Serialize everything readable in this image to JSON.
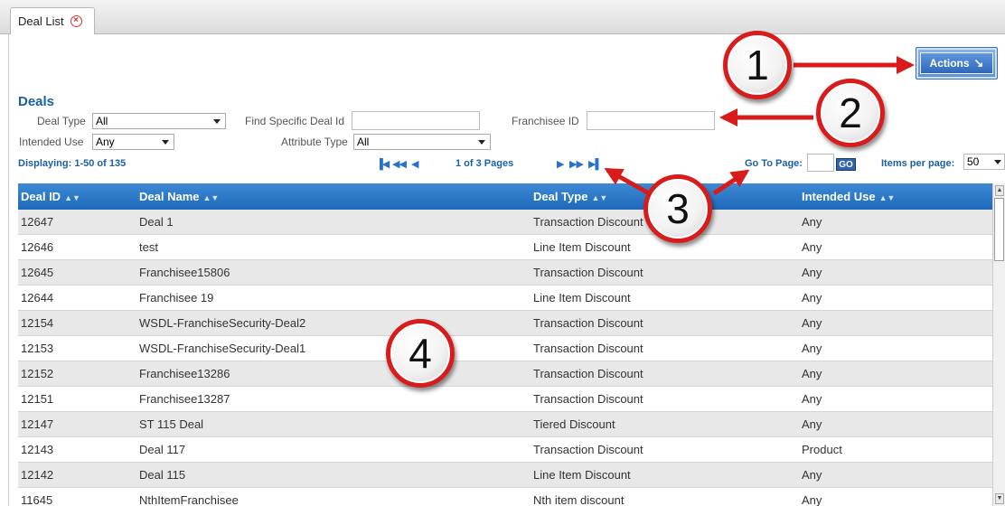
{
  "tab": {
    "label": "Deal List"
  },
  "actions": {
    "label": "Actions"
  },
  "deals_title": "Deals",
  "filters": {
    "deal_type": {
      "label": "Deal Type",
      "value": "All"
    },
    "find_deal": {
      "label": "Find Specific Deal Id",
      "value": ""
    },
    "franchisee": {
      "label": "Franchisee ID",
      "value": ""
    },
    "intended_use": {
      "label": "Intended Use",
      "value": "Any"
    },
    "attribute_type": {
      "label": "Attribute Type",
      "value": "All"
    }
  },
  "pager": {
    "displaying": "Displaying: 1-50 of 135",
    "page_of": "1 of 3 Pages",
    "goto_label": "Go To Page:",
    "go_button": "GO",
    "items_per_page_label": "Items per page:",
    "items_per_page": "50"
  },
  "table": {
    "columns": [
      "Deal ID",
      "Deal Name",
      "Deal Type",
      "Intended Use"
    ],
    "rows": [
      [
        "12647",
        "Deal 1",
        "Transaction Discount",
        "Any"
      ],
      [
        "12646",
        "test",
        "Line Item Discount",
        "Any"
      ],
      [
        "12645",
        "Franchisee15806",
        "Transaction Discount",
        "Any"
      ],
      [
        "12644",
        "Franchisee 19",
        "Line Item Discount",
        "Any"
      ],
      [
        "12154",
        "WSDL-FranchiseSecurity-Deal2",
        "Transaction Discount",
        "Any"
      ],
      [
        "12153",
        "WSDL-FranchiseSecurity-Deal1",
        "Transaction Discount",
        "Any"
      ],
      [
        "12152",
        "Franchisee13286",
        "Transaction Discount",
        "Any"
      ],
      [
        "12151",
        "Franchisee13287",
        "Transaction Discount",
        "Any"
      ],
      [
        "12147",
        "ST 115 Deal",
        "Tiered Discount",
        "Any"
      ],
      [
        "12143",
        "Deal 117",
        "Transaction Discount",
        "Product"
      ],
      [
        "12142",
        "Deal 115",
        "Line Item Discount",
        "Any"
      ],
      [
        "11645",
        "NthItemFranchisee",
        "Nth item discount",
        "Any"
      ]
    ]
  },
  "callouts": [
    "1",
    "2",
    "3",
    "4"
  ],
  "colors": {
    "accent": "#1b5fa5",
    "header": "#2a78c8",
    "callout_ring": "#d81b1b"
  }
}
